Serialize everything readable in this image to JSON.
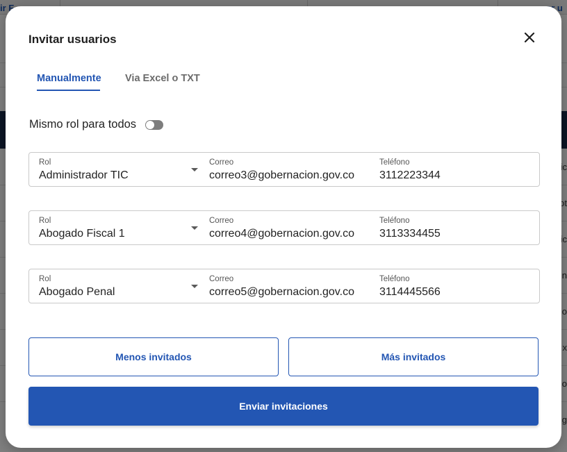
{
  "background": {
    "links": [
      "ir F",
      "ar u"
    ],
    "row_fragments": [
      "ic",
      "ot",
      "ic",
      "n",
      "o",
      "x",
      "o",
      "e",
      "g"
    ]
  },
  "modal": {
    "title": "Invitar usuarios",
    "close_icon": "close-icon",
    "tabs": [
      {
        "label": "Manualmente",
        "active": true
      },
      {
        "label": "Via Excel o TXT",
        "active": false
      }
    ],
    "same_role": {
      "label": "Mismo rol para todos",
      "enabled": false
    },
    "field_labels": {
      "role": "Rol",
      "email": "Correo",
      "phone": "Teléfono"
    },
    "invitees": [
      {
        "role": "Administrador TIC",
        "email": "correo3@gobernacion.gov.co",
        "phone": "3112223344"
      },
      {
        "role": "Abogado Fiscal 1",
        "email": "correo4@gobernacion.gov.co",
        "phone": "3113334455"
      },
      {
        "role": "Abogado Penal",
        "email": "correo5@gobernacion.gov.co",
        "phone": "3114445566"
      }
    ],
    "buttons": {
      "less": "Menos invitados",
      "more": "Más invitados",
      "send": "Enviar invitaciones"
    }
  },
  "colors": {
    "accent": "#2356b3",
    "toggle_off": "#7d7d7d",
    "header_band": "#172a4a"
  }
}
